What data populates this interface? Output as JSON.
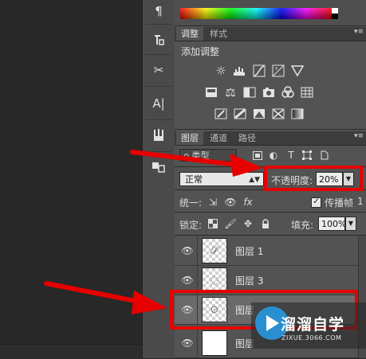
{
  "adjustments_panel": {
    "tabs": [
      "调整",
      "样式"
    ],
    "title": "添加调整",
    "icons": [
      "brightness-contrast-icon",
      "levels-icon",
      "curves-icon",
      "exposure-icon",
      "vibrance-icon",
      "hue-saturation-icon",
      "color-balance-icon",
      "black-white-icon",
      "photo-filter-icon",
      "channel-mixer-icon",
      "color-lookup-icon",
      "invert-icon",
      "posterize-icon",
      "threshold-icon",
      "selective-color-icon",
      "gradient-map-icon"
    ]
  },
  "layers_panel": {
    "tabs": [
      "图层",
      "通道",
      "路径"
    ],
    "filter_kind": "ρ 类型",
    "blend_mode": "正常",
    "opacity_label": "不透明度:",
    "opacity_value": "20%",
    "unify_label": "统一:",
    "propagate_label": "传播帧",
    "propagate_value": "1",
    "lock_label": "锁定:",
    "fill_label": "填充:",
    "fill_value": "100%",
    "layers": [
      {
        "name": "图层 1"
      },
      {
        "name": "图层 3"
      },
      {
        "name": "图层"
      },
      {
        "name": "图层"
      }
    ]
  },
  "watermark": {
    "text": "溜溜自学",
    "url": "ZIXUE.3066.COM"
  },
  "colors": {
    "annotation_red": "#e60000",
    "panel_bg": "#535353",
    "canvas_bg": "#282828"
  }
}
